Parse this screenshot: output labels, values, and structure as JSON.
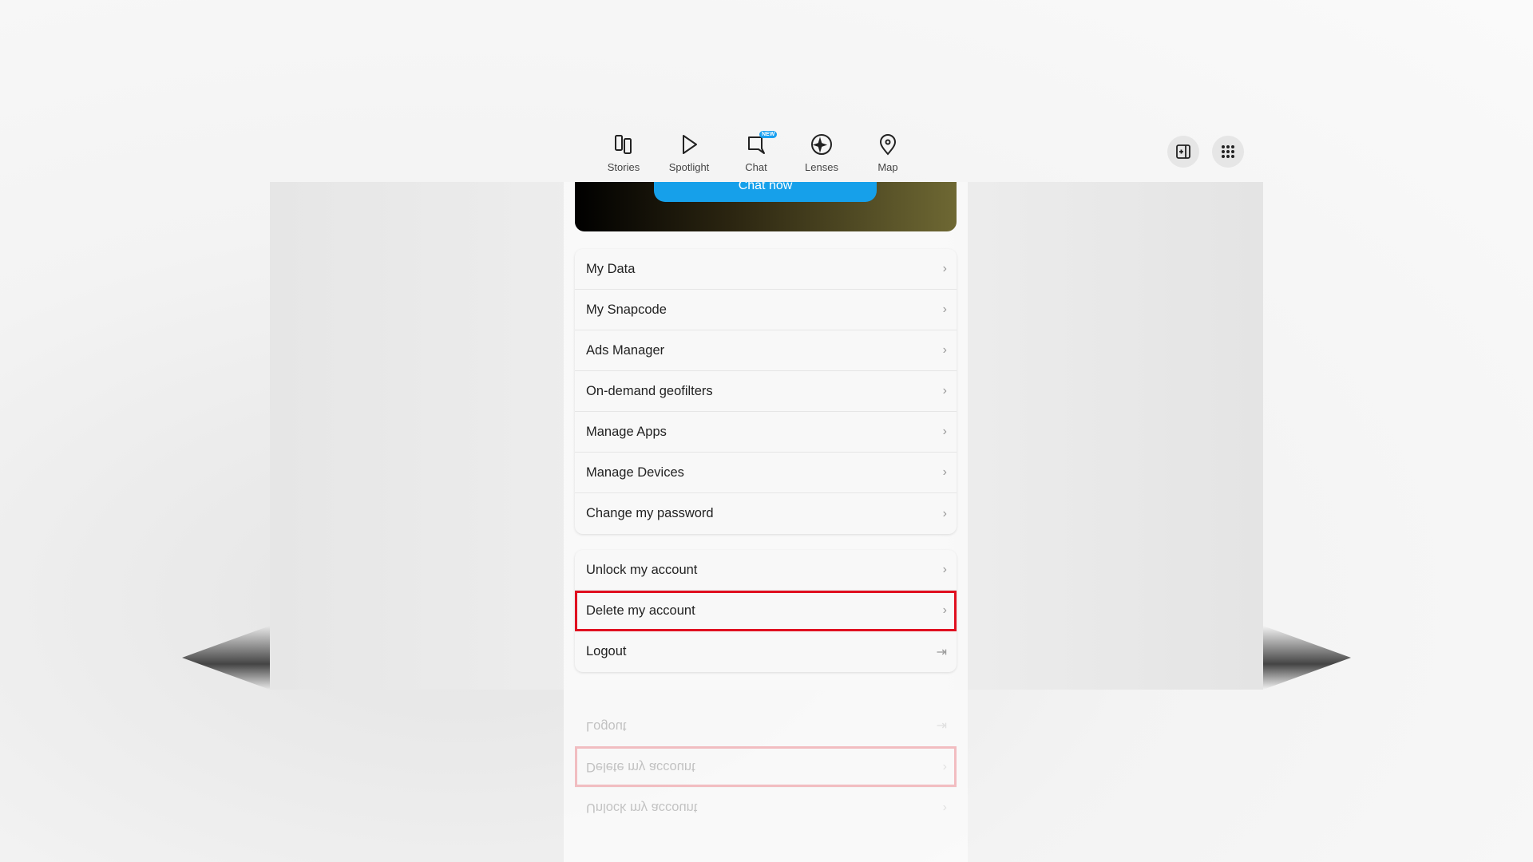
{
  "nav": {
    "items": [
      {
        "label": "Stories",
        "icon": "stories-icon"
      },
      {
        "label": "Spotlight",
        "icon": "play-icon"
      },
      {
        "label": "Chat",
        "icon": "chat-icon",
        "badge": "NEW"
      },
      {
        "label": "Lenses",
        "icon": "lenses-icon"
      },
      {
        "label": "Map",
        "icon": "map-pin-icon"
      }
    ]
  },
  "banner": {
    "button": "Chat now"
  },
  "menu1": [
    "My Data",
    "My Snapcode",
    "Ads Manager",
    "On-demand geofilters",
    "Manage Apps",
    "Manage Devices",
    "Change my password"
  ],
  "menu2": [
    "Unlock my account",
    "Delete my account",
    "Logout"
  ],
  "colors": {
    "accent": "#16a0ea",
    "highlight": "#e01020"
  }
}
